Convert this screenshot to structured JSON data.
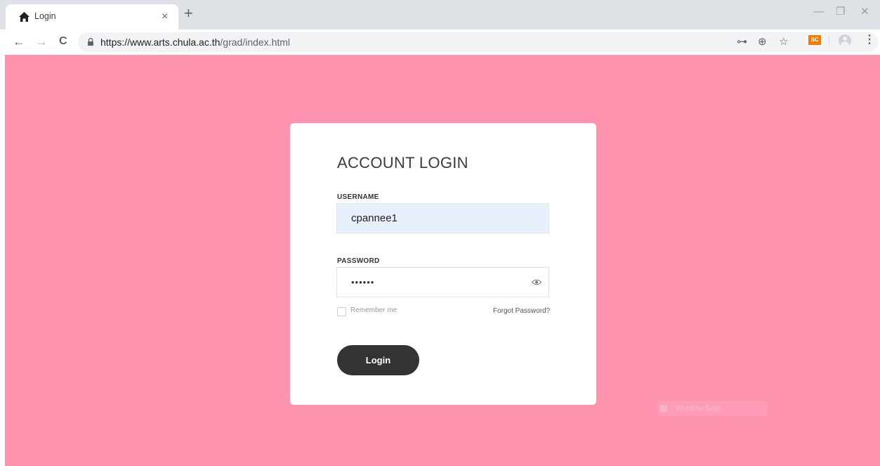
{
  "browser": {
    "tab_title": "Login",
    "tab_close_glyph": "×",
    "new_tab_glyph": "+",
    "window_controls": {
      "minimize": "—",
      "restore": "❐",
      "close": "✕"
    },
    "nav": {
      "back": "←",
      "forward": "→",
      "reload": "C"
    },
    "url_host": "https://www.arts.chula.ac.th",
    "url_path": "/grad/index.html",
    "toolbar_icons": [
      "key-icon",
      "zoom-icon",
      "star-icon",
      "extension-sc-icon",
      "profile-icon",
      "menu-icon"
    ],
    "toolbar_glyphs": {
      "key": "⊶",
      "zoom": "⊕",
      "star": "☆",
      "menu": "⋮"
    },
    "extension_label": "SC"
  },
  "page": {
    "background_color": "#ff94b1",
    "card": {
      "title": "ACCOUNT LOGIN",
      "username_label": "USERNAME",
      "username_value": "cpannee1",
      "password_label": "PASSWORD",
      "password_value": "••••••",
      "remember_label": "Remember me",
      "forgot_label": "Forgot Password?",
      "login_label": "Login"
    },
    "overlay_label": "Window Snip"
  }
}
